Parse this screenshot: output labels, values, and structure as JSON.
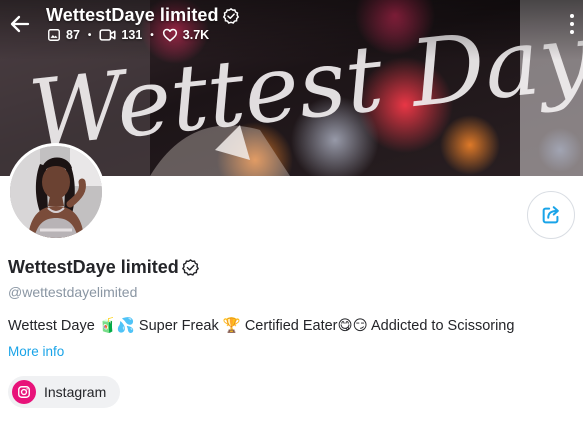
{
  "header": {
    "title": "WettestDaye limited",
    "stats": {
      "photos": "87",
      "videos": "131",
      "likes": "3.7K"
    }
  },
  "banner": {
    "watermark_text": "Wettest Daye"
  },
  "profile": {
    "display_name": "WettestDaye limited",
    "handle": "@wettestdayelimited",
    "bio": "Wettest Daye 🧃💦 Super Freak 🏆 Certified Eater😋😏 Addicted to Scissoring",
    "more_info_label": "More info",
    "social_links": [
      {
        "label": "Instagram",
        "icon": "instagram-icon"
      }
    ]
  },
  "colors": {
    "accent": "#1aa4e8",
    "instagram": "#e8137a",
    "handle": "#8a96a3"
  },
  "icons": {
    "back": "arrow-left-icon",
    "verified": "verified-check-icon",
    "photos": "image-icon",
    "videos": "video-camera-icon",
    "likes": "heart-icon",
    "more": "vertical-dots-icon",
    "share": "share-icon"
  }
}
